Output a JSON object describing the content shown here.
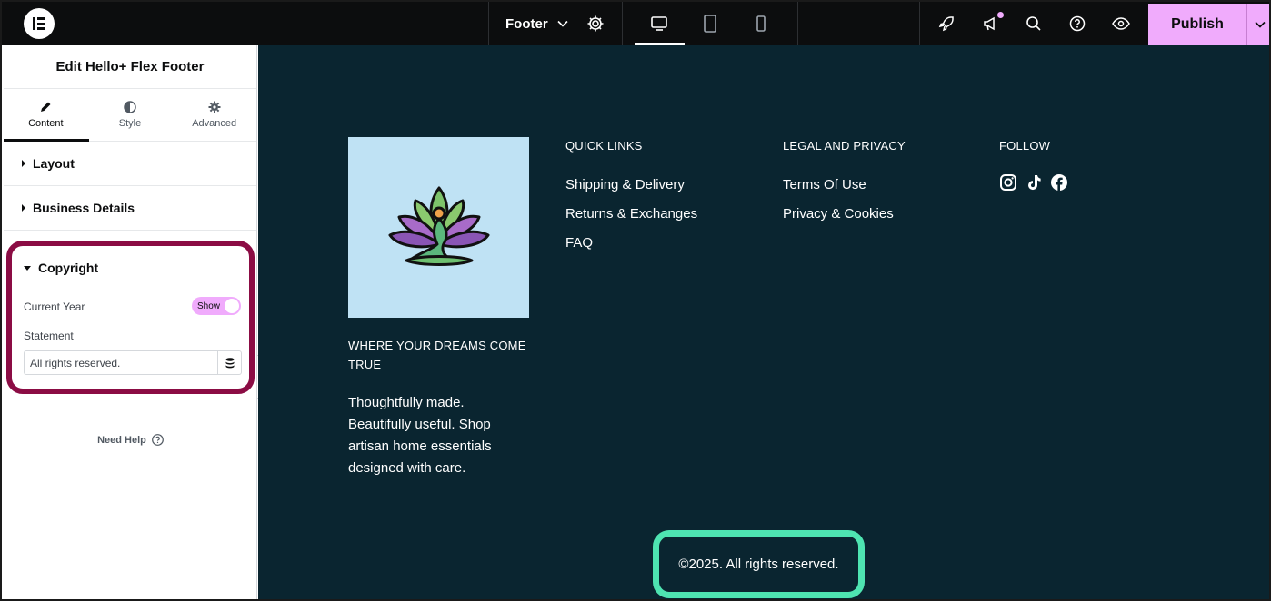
{
  "topbar": {
    "document_name": "Footer",
    "publish_label": "Publish",
    "icons": [
      "elementor-logo-icon",
      "chevron-down-icon",
      "gear-icon",
      "desktop-icon",
      "tablet-icon",
      "mobile-icon",
      "rocket-icon",
      "megaphone-icon",
      "search-icon",
      "help-icon",
      "eye-icon",
      "chevron-down-icon"
    ],
    "accent_color": "#f0abfc"
  },
  "sidebar": {
    "title": "Edit Hello+ Flex Footer",
    "tabs": [
      {
        "label": "Content",
        "icon": "pencil-icon",
        "active": true
      },
      {
        "label": "Style",
        "icon": "half-circle-icon",
        "active": false
      },
      {
        "label": "Advanced",
        "icon": "gear-icon",
        "active": false
      }
    ],
    "sections": {
      "layout": "Layout",
      "business": "Business Details",
      "copyright": "Copyright"
    },
    "copyright": {
      "current_year_label": "Current Year",
      "toggle_label": "Show",
      "statement_label": "Statement",
      "statement_value": "All rights reserved."
    },
    "need_help": "Need Help",
    "highlight_color": "#8b0c44"
  },
  "footer": {
    "tagline": "WHERE YOUR DREAMS COME TRUE",
    "description": "Thoughtfully made. Beautifully useful. Shop artisan home essentials designed with care.",
    "quick_links": {
      "heading": "QUICK LINKS",
      "items": [
        "Shipping & Delivery",
        "Returns & Exchanges",
        "FAQ"
      ]
    },
    "legal": {
      "heading": "LEGAL AND PRIVACY",
      "items": [
        "Terms Of Use",
        "Privacy & Cookies"
      ]
    },
    "follow": {
      "heading": "FOLLOW",
      "icons": [
        "instagram-icon",
        "tiktok-icon",
        "facebook-icon"
      ]
    },
    "copyright_text": "©2025. All rights reserved.",
    "background_color": "#0a2530",
    "highlight_color": "#4ee4b1"
  }
}
